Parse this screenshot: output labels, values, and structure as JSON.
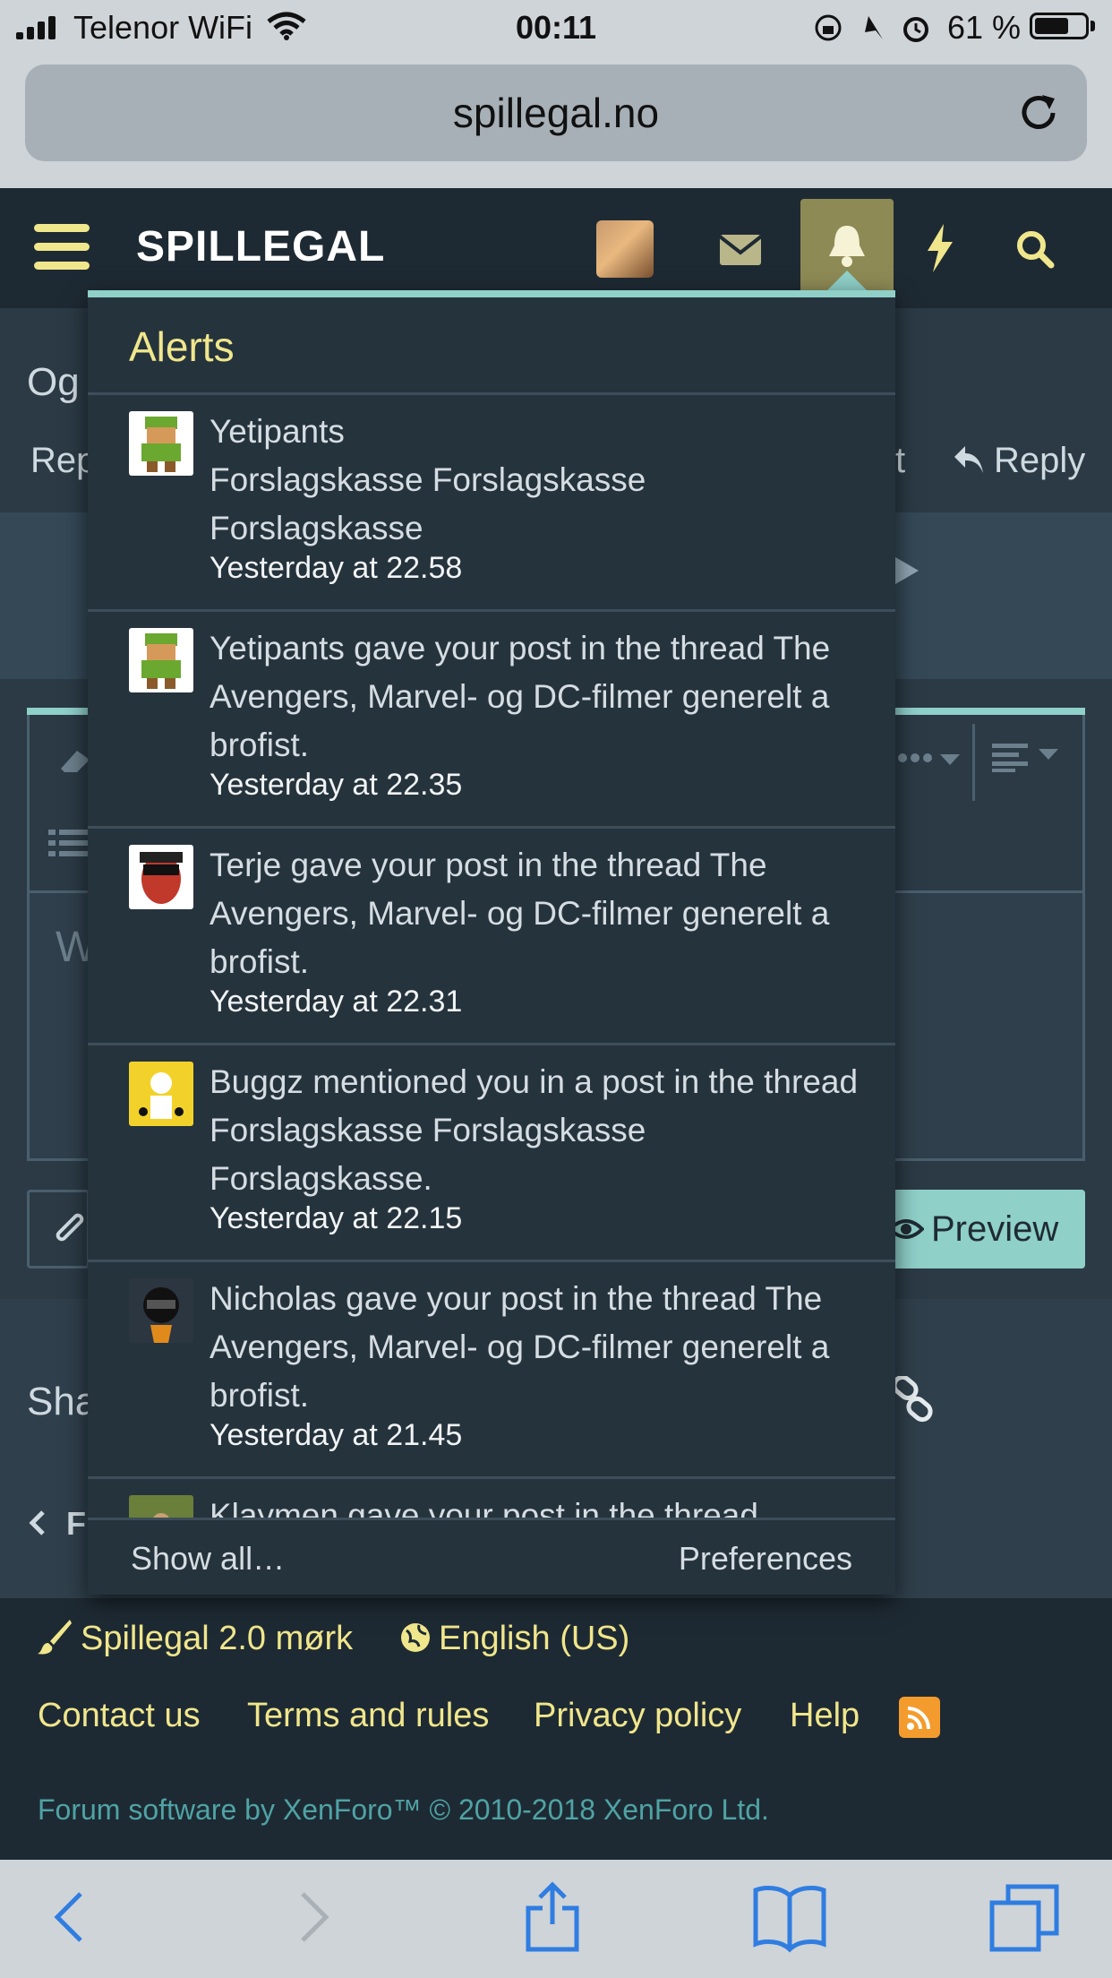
{
  "status": {
    "carrier": "Telenor WiFi",
    "time": "00:11",
    "battery": "61 %",
    "battery_level": 0.61
  },
  "browser": {
    "url": "spillegal.no"
  },
  "nav": {
    "logo": "SPILLEGAL"
  },
  "page": {
    "title_partial": "Og",
    "reply_left_partial": "Rep",
    "reply_right_partial": "t",
    "reply_label": "Reply",
    "placeholder_partial": "W",
    "preview_label": "Preview",
    "share_partial": "Sha",
    "prev_partial": "Fr"
  },
  "alerts": {
    "title": "Alerts",
    "items": [
      {
        "text": "Yetipants\nForslagskasse Forslagskasse Forslagskasse",
        "time": "Yesterday at 22.58"
      },
      {
        "text": "Yetipants gave your post in the thread The Avengers, Marvel- og DC-filmer generelt a brofist.",
        "time": "Yesterday at 22.35"
      },
      {
        "text": "Terje gave your post in the thread The Avengers, Marvel- og DC-filmer generelt a brofist.",
        "time": "Yesterday at 22.31"
      },
      {
        "text": "Buggz mentioned you in a post in the thread Forslagskasse Forslagskasse Forslagskasse.",
        "time": "Yesterday at 22.15"
      },
      {
        "text": "Nicholas gave your post in the thread The Avengers, Marvel- og DC-filmer generelt a brofist.",
        "time": "Yesterday at 21.45"
      },
      {
        "text": "Klaymen gave your post in the thread",
        "time": ""
      }
    ],
    "show_all": "Show all…",
    "preferences": "Preferences"
  },
  "footer": {
    "style": "Spillegal 2.0 mørk",
    "language": "English (US)",
    "links": [
      "Contact us",
      "Terms and rules",
      "Privacy policy",
      "Help"
    ],
    "copyright": "Forum software by XenForo™ © 2010-2018 XenForo Ltd."
  },
  "colors": {
    "accent": "#8fd0c9",
    "link": "#f0e68c",
    "nav": "#1e2a33",
    "panel": "#25333d"
  }
}
